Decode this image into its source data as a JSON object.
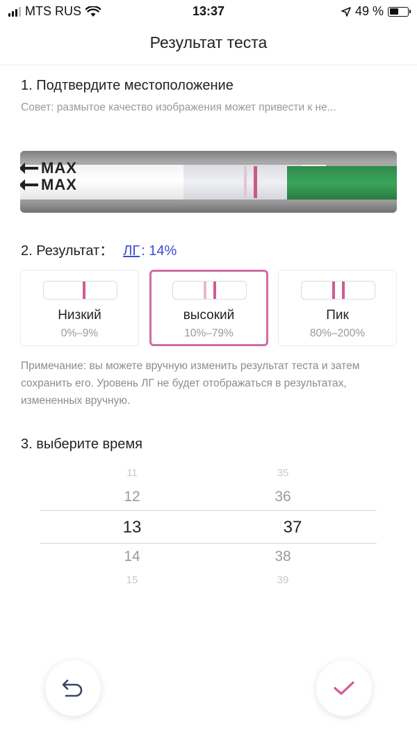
{
  "status_bar": {
    "carrier": "MTS RUS",
    "time": "13:37",
    "battery_percent": "49 %",
    "battery_level": 0.49
  },
  "header": {
    "title": "Результат теста"
  },
  "section1": {
    "title": "1. Подтвердите местоположение",
    "hint": "Совет: размытое качество изображения может привести к не..."
  },
  "strip_image": {
    "marking_top": "MAX",
    "marking_bottom": "MAX"
  },
  "section2": {
    "label": "2. Результат：",
    "lh_label": "ЛГ",
    "value": ": 14%",
    "accent_color": "#3c4bd0"
  },
  "levels": [
    {
      "name": "Низкий",
      "range": "0%–9%",
      "selected": false
    },
    {
      "name": "высокий",
      "range": "10%–79%",
      "selected": true
    },
    {
      "name": "Пик",
      "range": "80%–200%",
      "selected": false
    }
  ],
  "selection_color": "#d26aa3",
  "note": "Примечание: вы можете вручную изменить результат теста и затем сохранить его. Уровень ЛГ не будет отображаться в результатах, измененных вручную.",
  "section3": {
    "title": "3. выберите время"
  },
  "time_picker": {
    "hours": [
      "11",
      "12",
      "13",
      "14",
      "15"
    ],
    "minutes": [
      "35",
      "36",
      "37",
      "38",
      "39"
    ],
    "selected_hour": "13",
    "selected_minute": "37"
  },
  "buttons": {
    "undo_icon": "undo-arrow-icon",
    "confirm_icon": "checkmark-icon"
  }
}
